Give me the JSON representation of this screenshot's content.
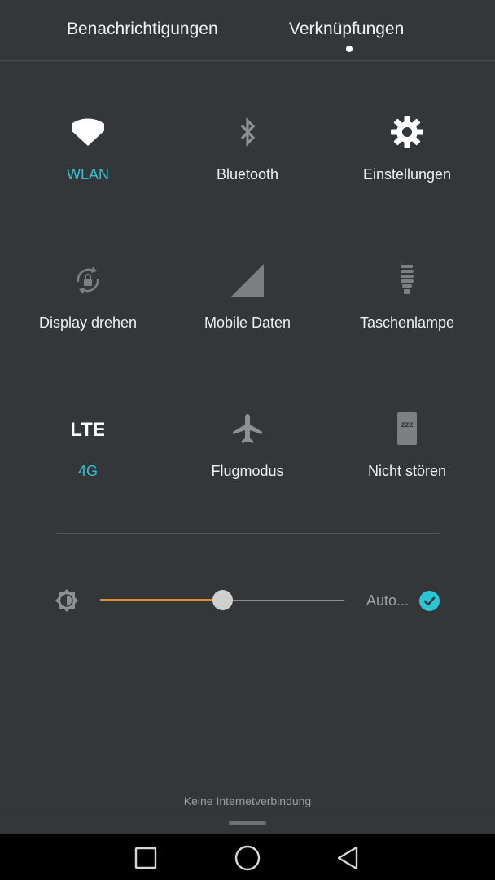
{
  "tabs": [
    {
      "label": "Benachrichtigungen"
    },
    {
      "label": "Verknüpfungen"
    }
  ],
  "tiles": [
    {
      "label": "WLAN",
      "icon": "wifi-icon",
      "active": true
    },
    {
      "label": "Bluetooth",
      "icon": "bluetooth-icon",
      "active": false
    },
    {
      "label": "Einstellungen",
      "icon": "gear-icon",
      "active": true
    },
    {
      "label": "Display drehen",
      "icon": "rotation-lock-icon",
      "active": false
    },
    {
      "label": "Mobile Daten",
      "icon": "cellular-signal-icon",
      "active": false
    },
    {
      "label": "Taschenlampe",
      "icon": "flashlight-icon",
      "active": false
    },
    {
      "label": "4G",
      "icon": "lte-icon",
      "icon_text": "LTE",
      "active": true
    },
    {
      "label": "Flugmodus",
      "icon": "airplane-icon",
      "active": false
    },
    {
      "label": "Nicht stören",
      "icon": "do-not-disturb-icon",
      "icon_text": "zzz",
      "active": false
    }
  ],
  "brightness": {
    "level": 0.5,
    "auto_label": "Auto...",
    "auto_checked": true
  },
  "status_text": "Keine Internetverbindung",
  "colors": {
    "accent": "#2bc6d6",
    "slider_fill": "#e38a2e",
    "background": "#33373a",
    "inactive_icon": "#8c9093"
  }
}
